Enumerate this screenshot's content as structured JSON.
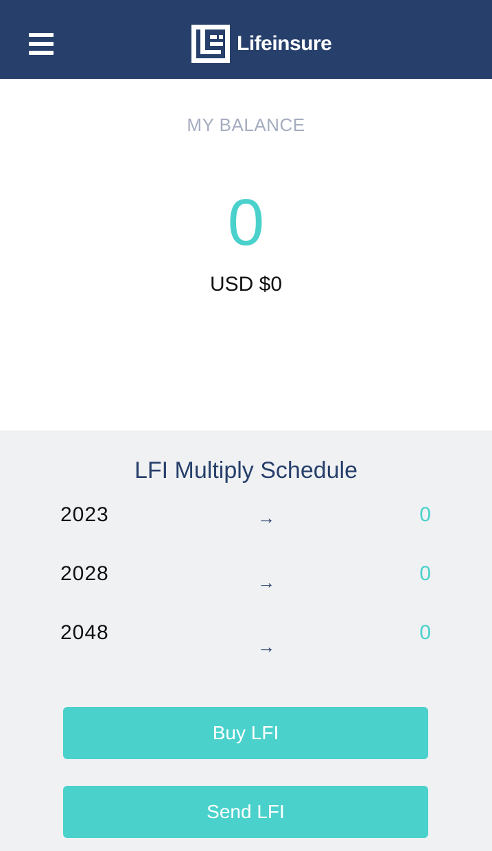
{
  "header": {
    "brand_name": "Lifeinsure",
    "menu_icon": "hamburger-menu-icon",
    "logo_icon": "lifeinsure-logo-icon",
    "background_color": "#27406b"
  },
  "balance": {
    "label": "MY BALANCE",
    "value": "0",
    "usd": "USD $0"
  },
  "schedule": {
    "title": "LFI Multiply Schedule",
    "arrow_icon": "right-arrow-icon",
    "rows": [
      {
        "year": "2023",
        "arrow": "→",
        "amount": "0"
      },
      {
        "year": "2028",
        "arrow": "→",
        "amount": "0"
      },
      {
        "year": "2048",
        "arrow": "→",
        "amount": "0"
      }
    ]
  },
  "actions": {
    "buy_label": "Buy LFI",
    "send_label": "Send LFI"
  },
  "colors": {
    "accent": "#4ad1cc",
    "navy": "#27406b",
    "label_gray": "#a4acbf",
    "panel_gray": "#f0f1f3"
  }
}
